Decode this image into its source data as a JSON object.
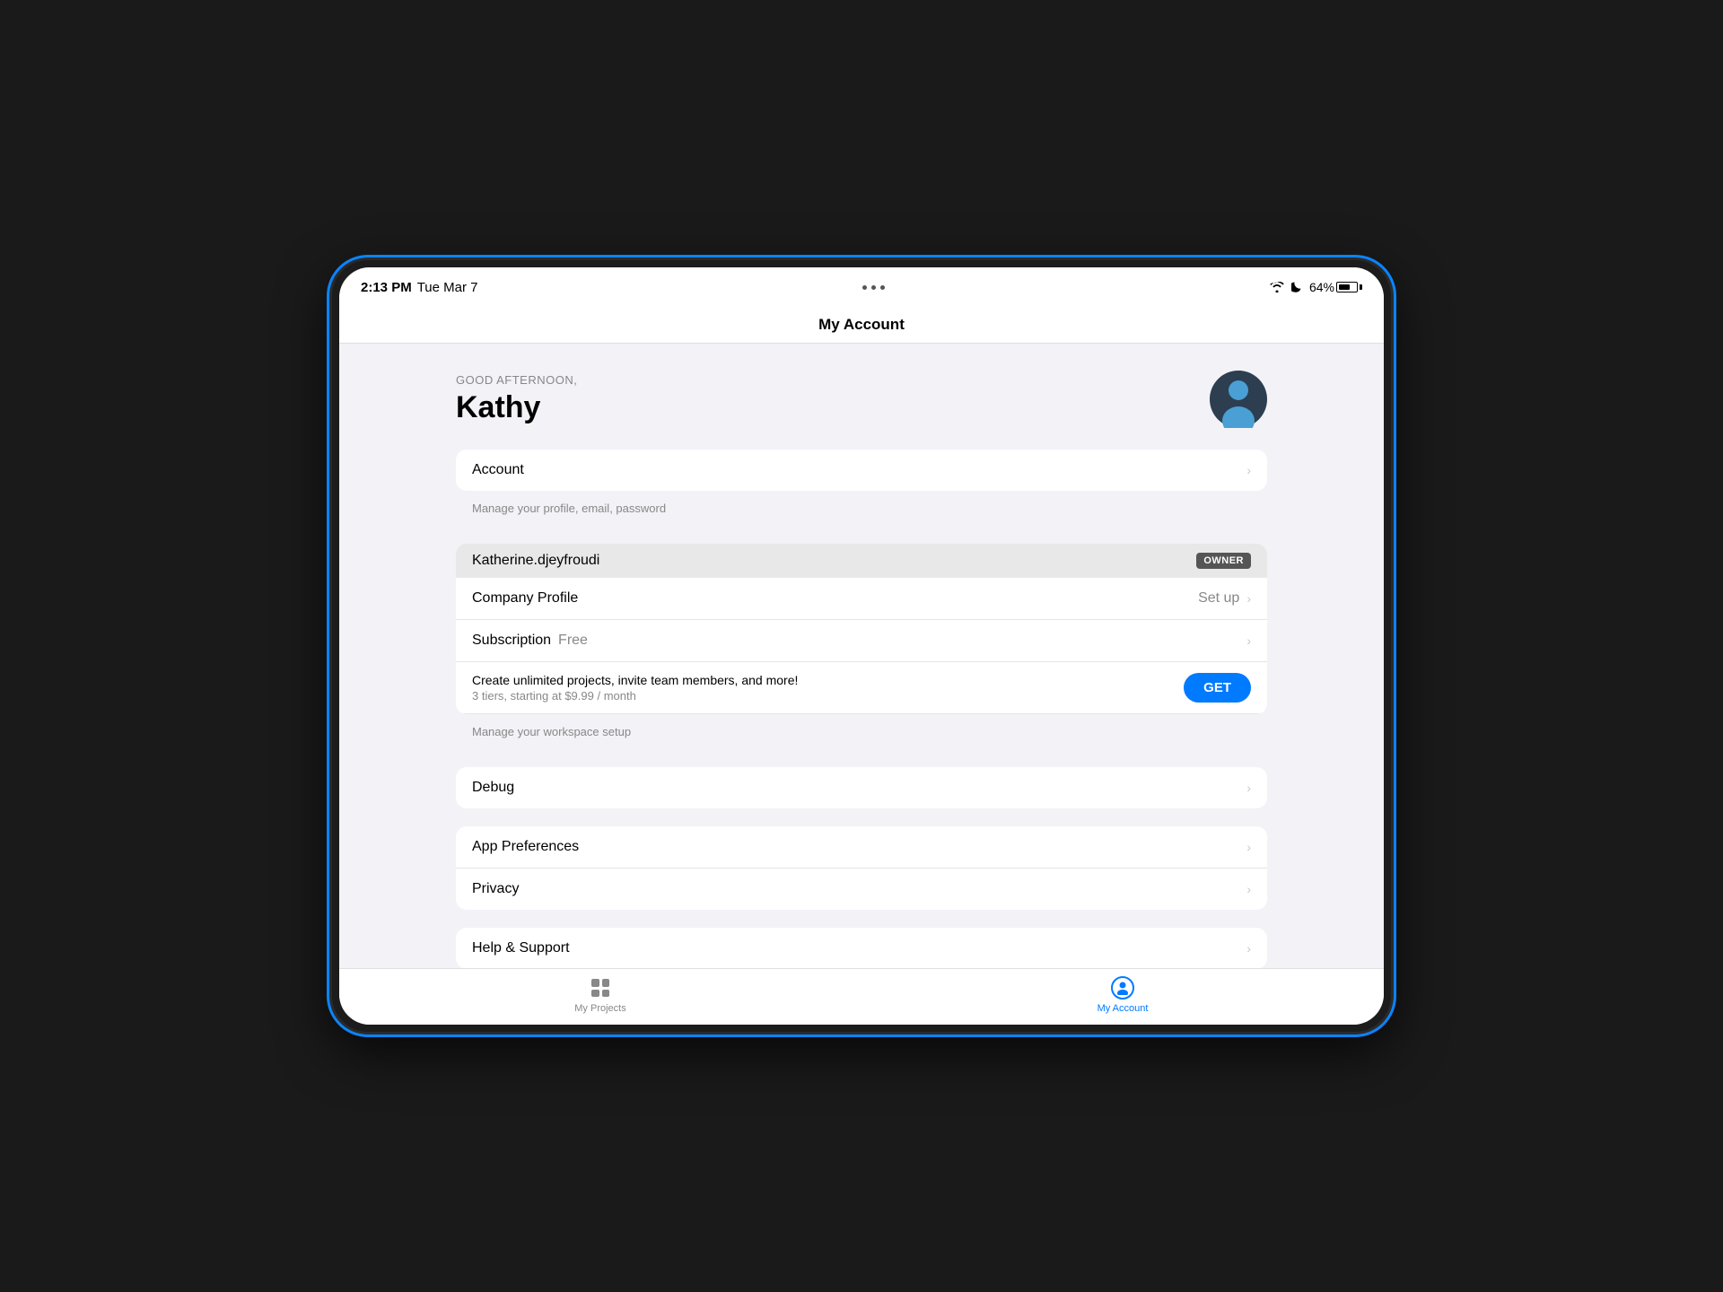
{
  "device": {
    "status_bar": {
      "time": "2:13 PM",
      "date": "Tue Mar 7",
      "battery_percent": "64%"
    }
  },
  "header": {
    "title": "My Account"
  },
  "page": {
    "greeting": "GOOD AFTERNOON,",
    "user_name": "Kathy"
  },
  "sections": {
    "account": {
      "label": "Account",
      "description": "Manage your profile, email, password"
    },
    "workspace": {
      "name": "Katherine.djeyfroudi",
      "badge": "OWNER"
    },
    "company_profile": {
      "label": "Company Profile",
      "value": "Set up"
    },
    "subscription": {
      "label": "Subscription",
      "value": "Free",
      "promo_main": "Create unlimited projects, invite team members, and more!",
      "promo_sub": "3 tiers, starting at $9.99 / month",
      "get_button": "GET",
      "description": "Manage your workspace setup"
    },
    "debug": {
      "label": "Debug"
    },
    "app_preferences": {
      "label": "App Preferences"
    },
    "privacy": {
      "label": "Privacy"
    },
    "help_support": {
      "label": "Help & Support"
    }
  },
  "tab_bar": {
    "projects": {
      "label": "My Projects"
    },
    "account": {
      "label": "My Account"
    }
  }
}
